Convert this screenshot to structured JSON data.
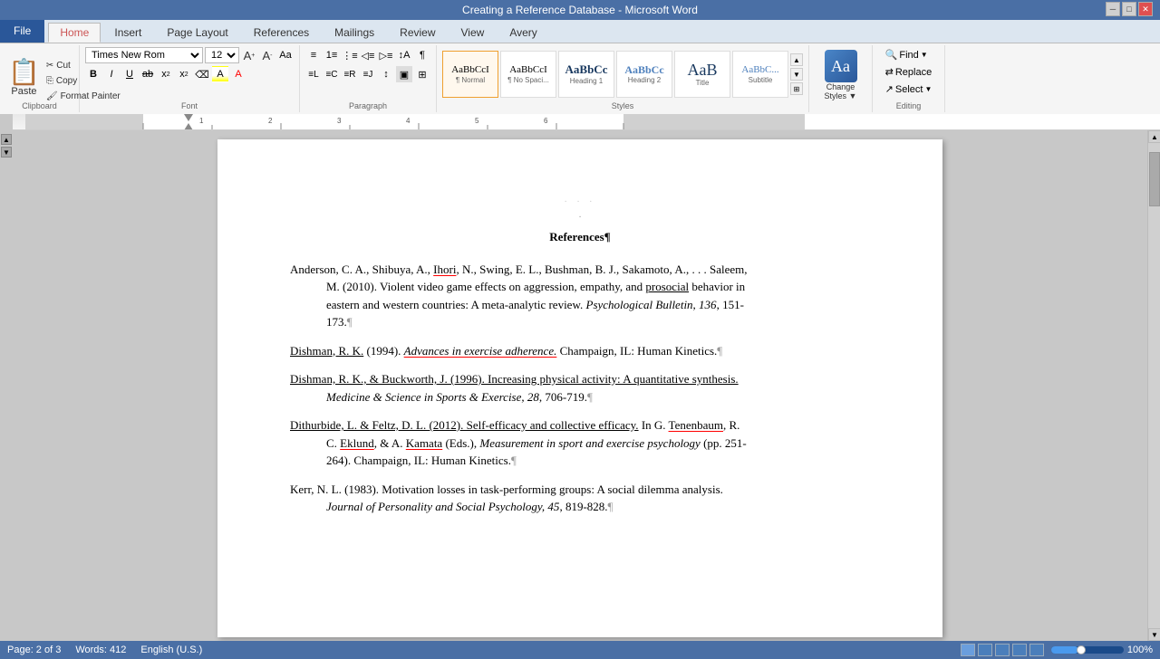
{
  "titlebar": {
    "title": "Creating a Reference Database - Microsoft Word",
    "min_btn": "─",
    "restore_btn": "□",
    "close_btn": "✕"
  },
  "tabs": [
    {
      "label": "File",
      "id": "file",
      "active": false
    },
    {
      "label": "Home",
      "id": "home",
      "active": true
    },
    {
      "label": "Insert",
      "id": "insert",
      "active": false
    },
    {
      "label": "Page Layout",
      "id": "page-layout",
      "active": false
    },
    {
      "label": "References",
      "id": "references",
      "active": false
    },
    {
      "label": "Mailings",
      "id": "mailings",
      "active": false
    },
    {
      "label": "Review",
      "id": "review",
      "active": false
    },
    {
      "label": "View",
      "id": "view",
      "active": false
    },
    {
      "label": "Avery",
      "id": "avery",
      "active": false
    }
  ],
  "groups": {
    "clipboard": {
      "label": "Clipboard",
      "paste_label": "Paste",
      "cut_label": "Cut",
      "copy_label": "Copy",
      "format_painter_label": "Format Painter"
    },
    "font": {
      "label": "Font",
      "font_name": "Times New Rom",
      "font_size": "12",
      "bold": "B",
      "italic": "I",
      "underline": "U",
      "strikethrough": "ab",
      "subscript": "x₂",
      "superscript": "x²"
    },
    "paragraph": {
      "label": "Paragraph"
    },
    "styles": {
      "label": "Styles",
      "items": [
        {
          "id": "normal",
          "preview_top": "AaBbCcI",
          "label": "¶ Normal",
          "selected": true
        },
        {
          "id": "no-spacing",
          "preview_top": "AaBbCcI",
          "label": "¶ No Spaci..."
        },
        {
          "id": "heading1",
          "preview_top": "AaBbCc",
          "label": "Heading 1"
        },
        {
          "id": "heading2",
          "preview_top": "AaBbCc",
          "label": "Heading 2"
        },
        {
          "id": "title",
          "preview_top": "AaB",
          "label": "Title"
        },
        {
          "id": "subtitle",
          "preview_top": "AaBbC...",
          "label": "Subtitle"
        }
      ]
    },
    "change_styles": {
      "label": "Change Styles",
      "button": "Change\nStyles"
    },
    "editing": {
      "label": "Editing",
      "find": "Find",
      "replace": "Replace",
      "select": "Select"
    }
  },
  "document": {
    "title": "References¶",
    "references": [
      {
        "id": "anderson",
        "lines": [
          "Anderson, C. A., Shibuya, A., Ihori, N., Swing, E. L., Bushman, B. J., Sakamoto, A., . . . Saleem,",
          "M. (2010). Violent video game effects on aggression, empathy, and prosocial behavior in",
          "eastern and western countries: A meta-analytic review. Psychological Bulletin, 136, 151-",
          "173.¶"
        ]
      },
      {
        "id": "dishman1994",
        "lines": [
          "Dishman, R. K. (1994). Advances in exercise adherence. Champaign, IL: Human Kinetics.¶"
        ]
      },
      {
        "id": "dishman1996",
        "lines": [
          "Dishman, R. K., & Buckworth, J. (1996). Increasing physical activity: A quantitative synthesis.",
          "Medicine & Science in Sports & Exercise, 28, 706-719.¶"
        ]
      },
      {
        "id": "dithurbide",
        "lines": [
          "Dithurbide, L. & Feltz, D. L. (2012). Self-efficacy and collective efficacy. In G. Tenenbaum, R.",
          "C. Eklund, & A. Kamata (Eds.), Measurement in sport and exercise psychology (pp. 251-",
          "264). Champaign, IL: Human Kinetics.¶"
        ]
      },
      {
        "id": "kerr",
        "lines": [
          "Kerr, N. L. (1983). Motivation losses in task-performing groups: A social dilemma analysis.",
          "Journal of Personality and Social Psychology, 45, 819-828.¶"
        ]
      }
    ]
  },
  "status": {
    "page": "Page: 2 of 3",
    "words": "Words: 412",
    "language": "English (U.S.)",
    "view_icons": [
      "print-layout-icon",
      "fullscreen-icon",
      "web-layout-icon",
      "outline-icon",
      "draft-icon"
    ],
    "zoom": "100%"
  }
}
